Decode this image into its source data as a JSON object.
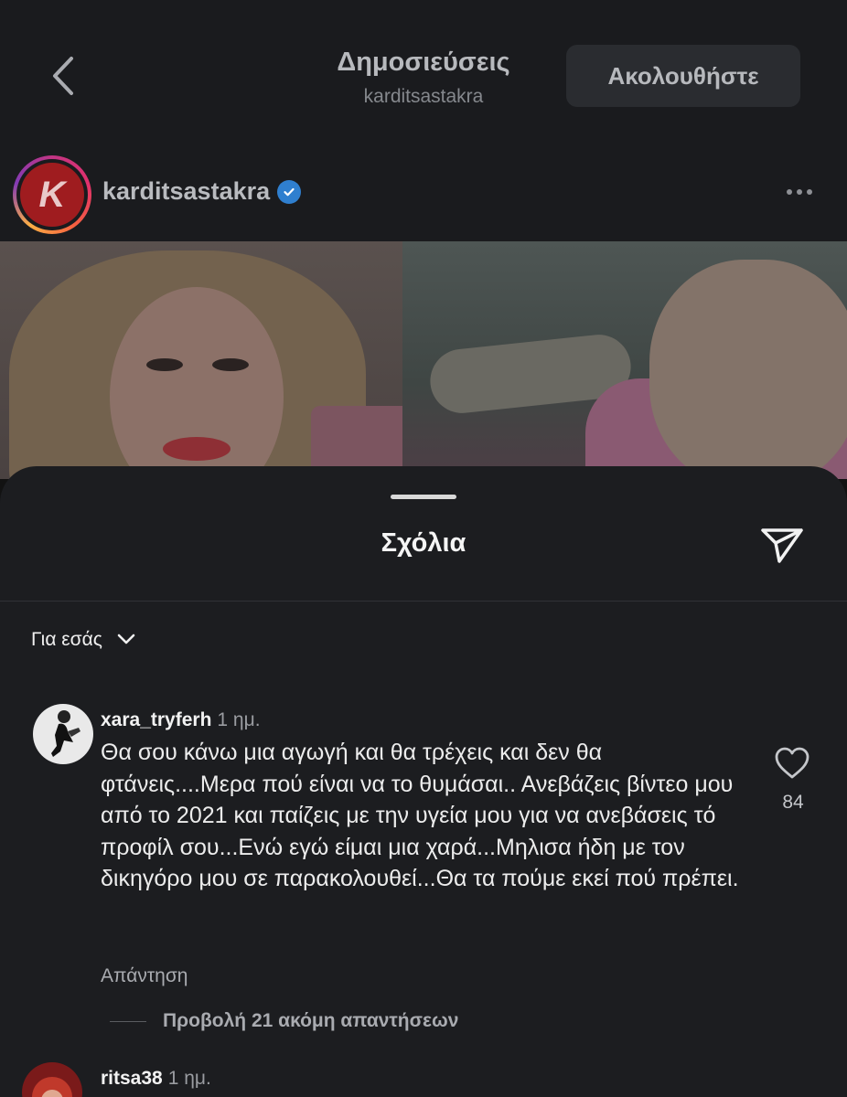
{
  "header": {
    "title": "Δημοσιεύσεις",
    "subtitle": "karditsastakra",
    "follow_label": "Ακολουθήστε"
  },
  "post": {
    "username": "karditsastakra",
    "avatar_letter": "K",
    "verified": true
  },
  "comments_sheet": {
    "title": "Σχόλια",
    "sort_label": "Για εσάς",
    "comments": [
      {
        "username": "xara_tryferh",
        "time": "1 ημ.",
        "text": "Θα σου κάνω μια αγωγή και θα τρέχεις και δεν θα φτάνεις....Μερα πού είναι να το θυμάσαι.. Ανεβάζεις βίντεο μου από το 2021 και παίζεις με την υγεία μου για να ανεβάσεις τό προφίλ σου...Ενώ εγώ είμαι μια χαρά...Μηλισα ήδη με τον δικηγόρο μου σε παρακολουθεί...Θα τα πούμε εκεί πού πρέπει.",
        "reply_label": "Απάντηση",
        "likes": "84",
        "view_replies_label": "Προβολή 21 ακόμη απαντήσεων"
      },
      {
        "username": "ritsa38",
        "time": "1 ημ."
      }
    ]
  },
  "colors": {
    "background": "#121212",
    "sheet": "#1c1d20",
    "verified_blue": "#2f7fcf",
    "brand_red": "#9f1c1f"
  },
  "icons": [
    "back-chevron-icon",
    "verified-badge-icon",
    "more-options-icon",
    "share-send-icon",
    "chevron-down-icon",
    "heart-icon"
  ]
}
